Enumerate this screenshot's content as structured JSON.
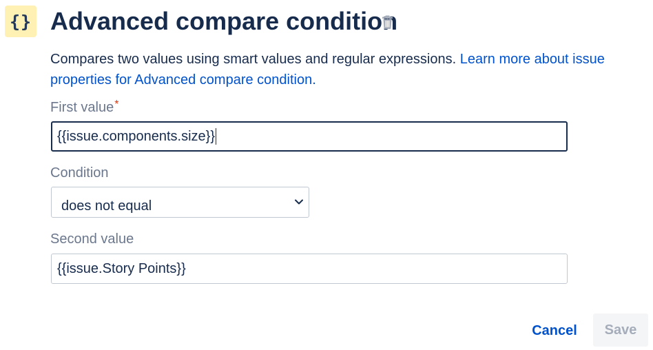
{
  "header": {
    "icon_glyph": "{}",
    "icon_name": "curly-braces-icon",
    "title": "Advanced compare condition",
    "delete_icon_name": "trash-icon"
  },
  "description": {
    "text": "Compares two values using smart values and regular expressions. ",
    "link_text": "Learn more about issue properties for Advanced compare condition."
  },
  "first_value": {
    "label": "First value",
    "required_marker": "*",
    "value": "{{issue.components.size}}"
  },
  "condition": {
    "label": "Condition",
    "selected": "does not equal"
  },
  "second_value": {
    "label": "Second value",
    "value": "{{issue.Story Points}}"
  },
  "actions": {
    "cancel_label": "Cancel",
    "save_label": "Save"
  },
  "colors": {
    "text": "#172b4d",
    "link": "#0052cc",
    "label": "#6b778c",
    "required": "#de350b",
    "icon_badge_bg": "#fff0b3",
    "disabled_button_bg": "#f4f5f7",
    "disabled_button_text": "#a5adba"
  }
}
